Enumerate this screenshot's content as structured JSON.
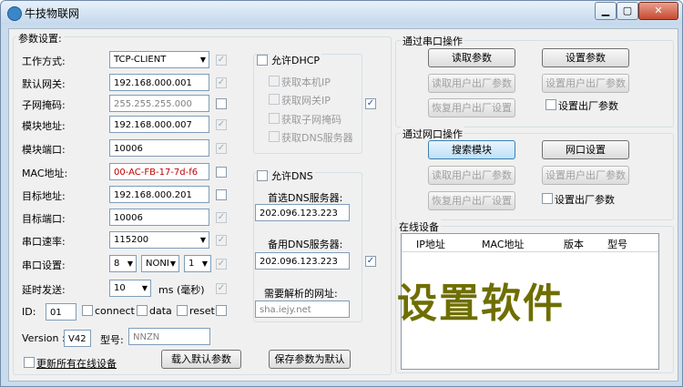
{
  "window": {
    "title": "牛技物联网",
    "min_label": "▁",
    "max_label": "▢",
    "close_label": "✕"
  },
  "params": {
    "group_title": "参数设置:",
    "rows": [
      {
        "label": "工作方式:",
        "value": "TCP-CLIENT"
      },
      {
        "label": "默认网关:",
        "value": "192.168.000.001"
      },
      {
        "label": "子网掩码:",
        "value": "255.255.255.000"
      },
      {
        "label": "模块地址:",
        "value": "192.168.000.007"
      },
      {
        "label": "模块端口:",
        "value": "10006"
      },
      {
        "label": "MAC地址:",
        "value": "00-AC-FB-17-7d-f6"
      },
      {
        "label": "目标地址:",
        "value": "192.168.000.201"
      },
      {
        "label": "目标端口:",
        "value": "10006"
      },
      {
        "label": "串口速率:",
        "value": "115200"
      },
      {
        "label": "串口设置:",
        "databits": "8",
        "parity": "NONI",
        "stopbits": "1"
      },
      {
        "label": "延时发送:",
        "value": "10",
        "unit": "ms (毫秒)"
      }
    ],
    "id_label": "ID:",
    "id_value": "01",
    "connect_label": "connect",
    "data_label": "data",
    "reset_label": "reset",
    "version_label": "Version :",
    "version_value": "V42",
    "model_label": "型号:",
    "model_value": "NNZN",
    "update_all_label": "更新所有在线设备",
    "load_default_label": "载入默认参数",
    "save_default_label": "保存参数为默认"
  },
  "dhcp": {
    "allow_label": "允许DHCP",
    "items": [
      "获取本机IP",
      "获取网关IP",
      "获取子网掩码",
      "获取DNS服务器"
    ]
  },
  "dns": {
    "allow_label": "允许DNS",
    "primary_label": "首选DNS服务器:",
    "primary_value": "202.096.123.223",
    "backup_label": "备用DNS服务器:",
    "backup_value": "202.096.123.223",
    "resolve_label": "需要解析的网址:",
    "resolve_value": "sha.iejy.net"
  },
  "serial_ops": {
    "title": "通过串口操作",
    "read_params": "读取参数",
    "set_params": "设置参数",
    "read_user": "读取用户出厂参数",
    "set_user": "设置用户出厂参数",
    "restore_user": "恢复用户出厂设置",
    "set_factory": "设置出厂参数"
  },
  "net_ops": {
    "title": "通过网口操作",
    "search": "搜索模块",
    "net_settings": "网口设置",
    "read_user": "读取用户出厂参数",
    "set_user": "设置用户出厂参数",
    "restore_user": "恢复用户出厂设置",
    "set_factory": "设置出厂参数"
  },
  "online": {
    "title": "在线设备",
    "columns": [
      "IP地址",
      "MAC地址",
      "版本",
      "型号"
    ],
    "watermark": "设置软件"
  }
}
